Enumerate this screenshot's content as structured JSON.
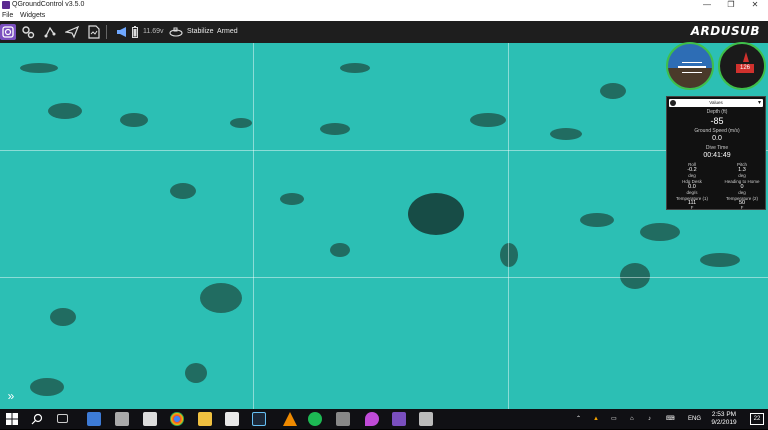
{
  "window": {
    "title": "QGroundControl v3.5.0",
    "minimize": "—",
    "maximize": "❐",
    "close": "✕"
  },
  "menu": {
    "file": "File",
    "widgets": "Widgets"
  },
  "toolbar": {
    "battery": "11.69v",
    "mode": "Stabilize",
    "armed": "Armed",
    "brand_a": "ARDU",
    "brand_b": "SUB"
  },
  "instrument": {
    "selector": "Values",
    "depth_label": "Depth (ft)",
    "depth_value": "-85",
    "speed_label": "Ground Speed (m/s)",
    "speed_value": "0.0",
    "dive_label": "Dive Time",
    "dive_value": "00:41:49",
    "roll_label": "Roll",
    "roll_value": "-0.2",
    "roll_unit": "deg",
    "pitch_label": "Pitch",
    "pitch_value": "1.3",
    "pitch_unit": "deg",
    "heading_label": "Hdg Desk",
    "heading_value": "0.0",
    "heading_unit": "deg/s",
    "hold_label": "Heading to Home",
    "hold_value": "0",
    "hold_unit": "deg",
    "temp1_label": "Temperature (1)",
    "temp1_value": "111",
    "temp1_unit": "F",
    "temp2_label": "Temperature (2)",
    "temp2_value": "50",
    "temp2_unit": "F",
    "compass_value": "126"
  },
  "taskbar": {
    "lang": "ENG",
    "time": "2:53 PM",
    "date": "9/2/2019",
    "notif": "22"
  },
  "colors": {
    "water": "#2cbfb4",
    "accent": "#7a4fbf",
    "dial": "#3fbf4a"
  }
}
